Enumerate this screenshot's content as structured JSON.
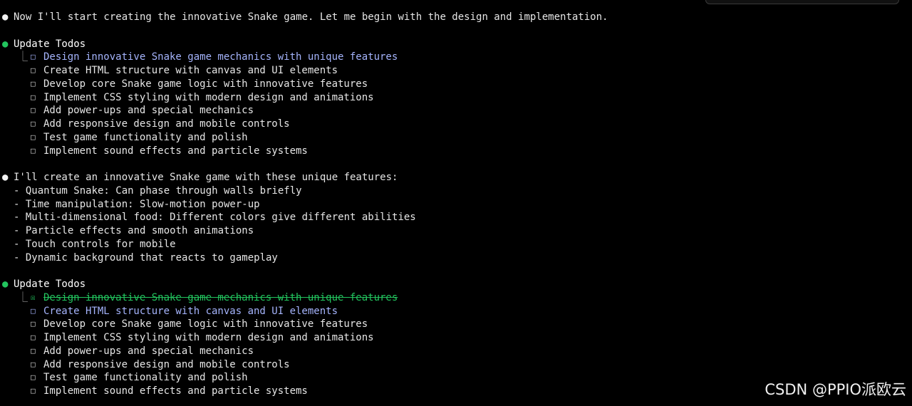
{
  "messages": {
    "intro": "Now I'll start creating the innovative Snake game. Let me begin with the design and implementation.",
    "features_intro": "I'll create an innovative Snake game with these unique features:",
    "features": [
      "- Quantum Snake: Can phase through walls briefly",
      "- Time manipulation: Slow-motion power-up",
      "- Multi-dimensional food: Different colors give different abilities",
      "- Particle effects and smooth animations",
      "- Touch controls for mobile",
      "- Dynamic background that reacts to gameplay"
    ]
  },
  "todo_blocks": [
    {
      "header": "Update Todos",
      "items": [
        {
          "label": "Design innovative Snake game mechanics with unique features",
          "state": "active",
          "box": "□"
        },
        {
          "label": "Create HTML structure with canvas and UI elements",
          "state": "pending",
          "box": "□"
        },
        {
          "label": "Develop core Snake game logic with innovative features",
          "state": "pending",
          "box": "□"
        },
        {
          "label": "Implement CSS styling with modern design and animations",
          "state": "pending",
          "box": "□"
        },
        {
          "label": "Add power-ups and special mechanics",
          "state": "pending",
          "box": "□"
        },
        {
          "label": "Add responsive design and mobile controls",
          "state": "pending",
          "box": "□"
        },
        {
          "label": "Test game functionality and polish",
          "state": "pending",
          "box": "□"
        },
        {
          "label": "Implement sound effects and particle systems",
          "state": "pending",
          "box": "□"
        }
      ]
    },
    {
      "header": "Update Todos",
      "items": [
        {
          "label": "Design innovative Snake game mechanics with unique features",
          "state": "done",
          "box": "☒"
        },
        {
          "label": "Create HTML structure with canvas and UI elements",
          "state": "active",
          "box": "□"
        },
        {
          "label": "Develop core Snake game logic with innovative features",
          "state": "pending",
          "box": "□"
        },
        {
          "label": "Implement CSS styling with modern design and animations",
          "state": "pending",
          "box": "□"
        },
        {
          "label": "Add power-ups and special mechanics",
          "state": "pending",
          "box": "□"
        },
        {
          "label": "Add responsive design and mobile controls",
          "state": "pending",
          "box": "□"
        },
        {
          "label": "Test game functionality and polish",
          "state": "pending",
          "box": "□"
        },
        {
          "label": "Implement sound effects and particle systems",
          "state": "pending",
          "box": "□"
        }
      ]
    }
  ],
  "glyphs": {
    "bullet": "●",
    "corner": "⎿"
  },
  "colors": {
    "background": "#000000",
    "text": "#e6e6e6",
    "accent_green": "#22c55e",
    "active_item": "#a5b4fc"
  },
  "watermark": "CSDN @PPIO派欧云"
}
